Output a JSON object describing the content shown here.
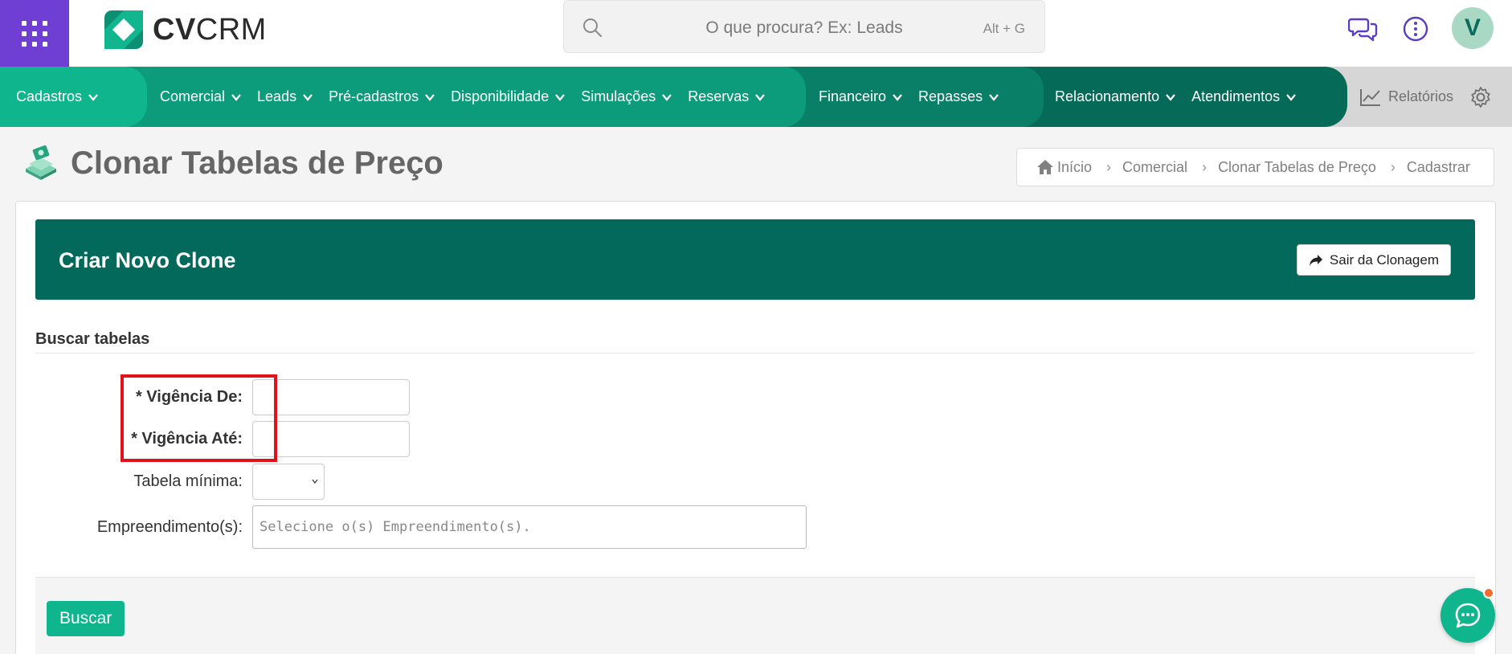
{
  "app": {
    "logo_text_bold": "CV",
    "logo_text_regular": "CRM"
  },
  "search": {
    "placeholder": "O que procura? Ex: Leads",
    "shortcut": "Alt + G"
  },
  "user": {
    "avatar_initial": "V"
  },
  "nav": {
    "group1": [
      {
        "label": "Cadastros"
      }
    ],
    "group2": [
      {
        "label": "Comercial"
      },
      {
        "label": "Leads"
      },
      {
        "label": "Pré-cadastros"
      },
      {
        "label": "Disponibilidade"
      },
      {
        "label": "Simulações"
      },
      {
        "label": "Reservas"
      }
    ],
    "group3": [
      {
        "label": "Financeiro"
      },
      {
        "label": "Repasses"
      }
    ],
    "group4": [
      {
        "label": "Relacionamento"
      },
      {
        "label": "Atendimentos"
      }
    ],
    "reports_label": "Relatórios"
  },
  "page": {
    "title": "Clonar Tabelas de Preço"
  },
  "breadcrumb": [
    "Início",
    "Comercial",
    "Clonar Tabelas de Preço",
    "Cadastrar"
  ],
  "panel": {
    "header_title": "Criar Novo Clone",
    "exit_button": "Sair da Clonagem",
    "section_title": "Buscar tabelas",
    "fields": {
      "vigencia_de_label": "* Vigência De:",
      "vigencia_ate_label": "* Vigência Até:",
      "tabela_minima_label": "Tabela mínima:",
      "empreendimentos_label": "Empreendimento(s):",
      "empreendimentos_placeholder": "Selecione o(s) Empreendimento(s)."
    },
    "search_button": "Buscar"
  },
  "colors": {
    "brand_purple": "#6f3fd4",
    "brand_green": "#0fb58d",
    "header_dark_green": "#03695a",
    "highlight_red": "#e0121c"
  }
}
